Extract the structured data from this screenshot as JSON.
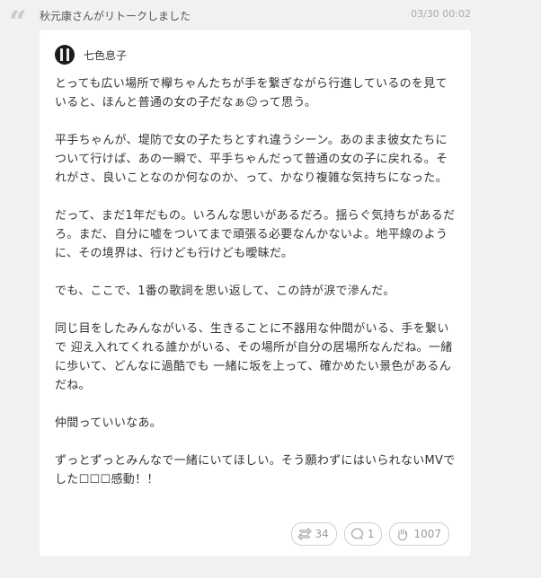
{
  "header": {
    "retalk_text": "秋元康さんがリトークしました",
    "timestamp": "03/30 00:02"
  },
  "post": {
    "author_name": "七色息子",
    "paragraphs": [
      "とっても広い場所で欅ちゃんたちが手を繋ぎながら行進しているのを見ていると、ほんと普通の女の子だなぁ☺って思う。",
      "平手ちゃんが、堤防で女の子たちとすれ違うシーン。あのまま彼女たちについて行けば、あの一瞬で、平手ちゃんだって普通の女の子に戻れる。それがさ、良いことなのか何なのか、って、かなり複雑な気持ちになった。",
      "だって、まだ1年だもの。いろんな思いがあるだろ。揺らぐ気持ちがあるだろ。まだ、自分に嘘をついてまで頑張る必要なんかないよ。地平線のように、その境界は、行けども行けども曖昧だ。",
      "でも、ここで、1番の歌詞を思い返して、この詩が涙で滲んだ。",
      "同じ目をしたみんながいる、生きることに不器用な仲間がいる、手を繋いで 迎え入れてくれる誰かがいる、その場所が自分の居場所なんだね。一緒に歩いて、どんなに過酷でも 一緒に坂を上って、確かめたい景色があるんだね。",
      "仲間っていいなあ。",
      "ずっとずっとみんなで一緒にいてほしい。そう願わずにはいられないMVでした☐☐☐感動！！"
    ],
    "actions": {
      "retalk_count": "34",
      "comment_count": "1",
      "clap_count": "1007"
    }
  },
  "icons": [
    "quote-icon",
    "avatar",
    "retalk-icon",
    "comment-icon",
    "clap-icon"
  ]
}
